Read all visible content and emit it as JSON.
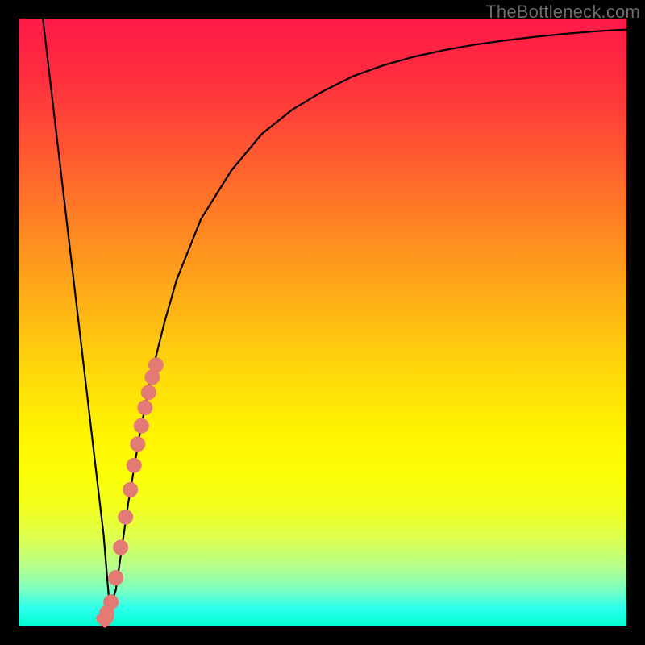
{
  "watermark": {
    "text": "TheBottleneck.com"
  },
  "colors": {
    "curve": "#000000",
    "marker_fill": "#e47a74",
    "marker_stroke": "#e47a74"
  },
  "chart_data": {
    "type": "line",
    "title": "",
    "xlabel": "",
    "ylabel": "",
    "xlim": [
      0,
      100
    ],
    "ylim": [
      0,
      100
    ],
    "grid": false,
    "series": [
      {
        "name": "bottleneck-curve",
        "x": [
          4,
          6,
          8,
          10,
          12,
          14,
          15,
          16,
          18,
          20,
          22,
          24,
          26,
          28,
          30,
          35,
          40,
          45,
          50,
          55,
          60,
          65,
          70,
          75,
          80,
          85,
          90,
          95,
          100
        ],
        "values": [
          100,
          83,
          66,
          49,
          32,
          15,
          3,
          6,
          20,
          32,
          42,
          50,
          57,
          62,
          67,
          75,
          81,
          85,
          88,
          90.5,
          92.3,
          93.7,
          94.8,
          95.7,
          96.4,
          97,
          97.5,
          97.9,
          98.2
        ]
      }
    ],
    "markers": {
      "name": "highlighted-segment",
      "x": [
        14.5,
        15.2,
        16.0,
        16.8,
        17.6,
        18.4,
        19.0,
        19.6,
        20.2,
        20.8,
        21.4,
        22.0,
        22.6
      ],
      "y": [
        2.2,
        4.0,
        8.0,
        13.0,
        18.0,
        22.5,
        26.5,
        30.0,
        33.0,
        36.0,
        38.5,
        41.0,
        43.0
      ]
    },
    "vertex_marker": {
      "x": 14.2,
      "y": 1.2
    }
  }
}
